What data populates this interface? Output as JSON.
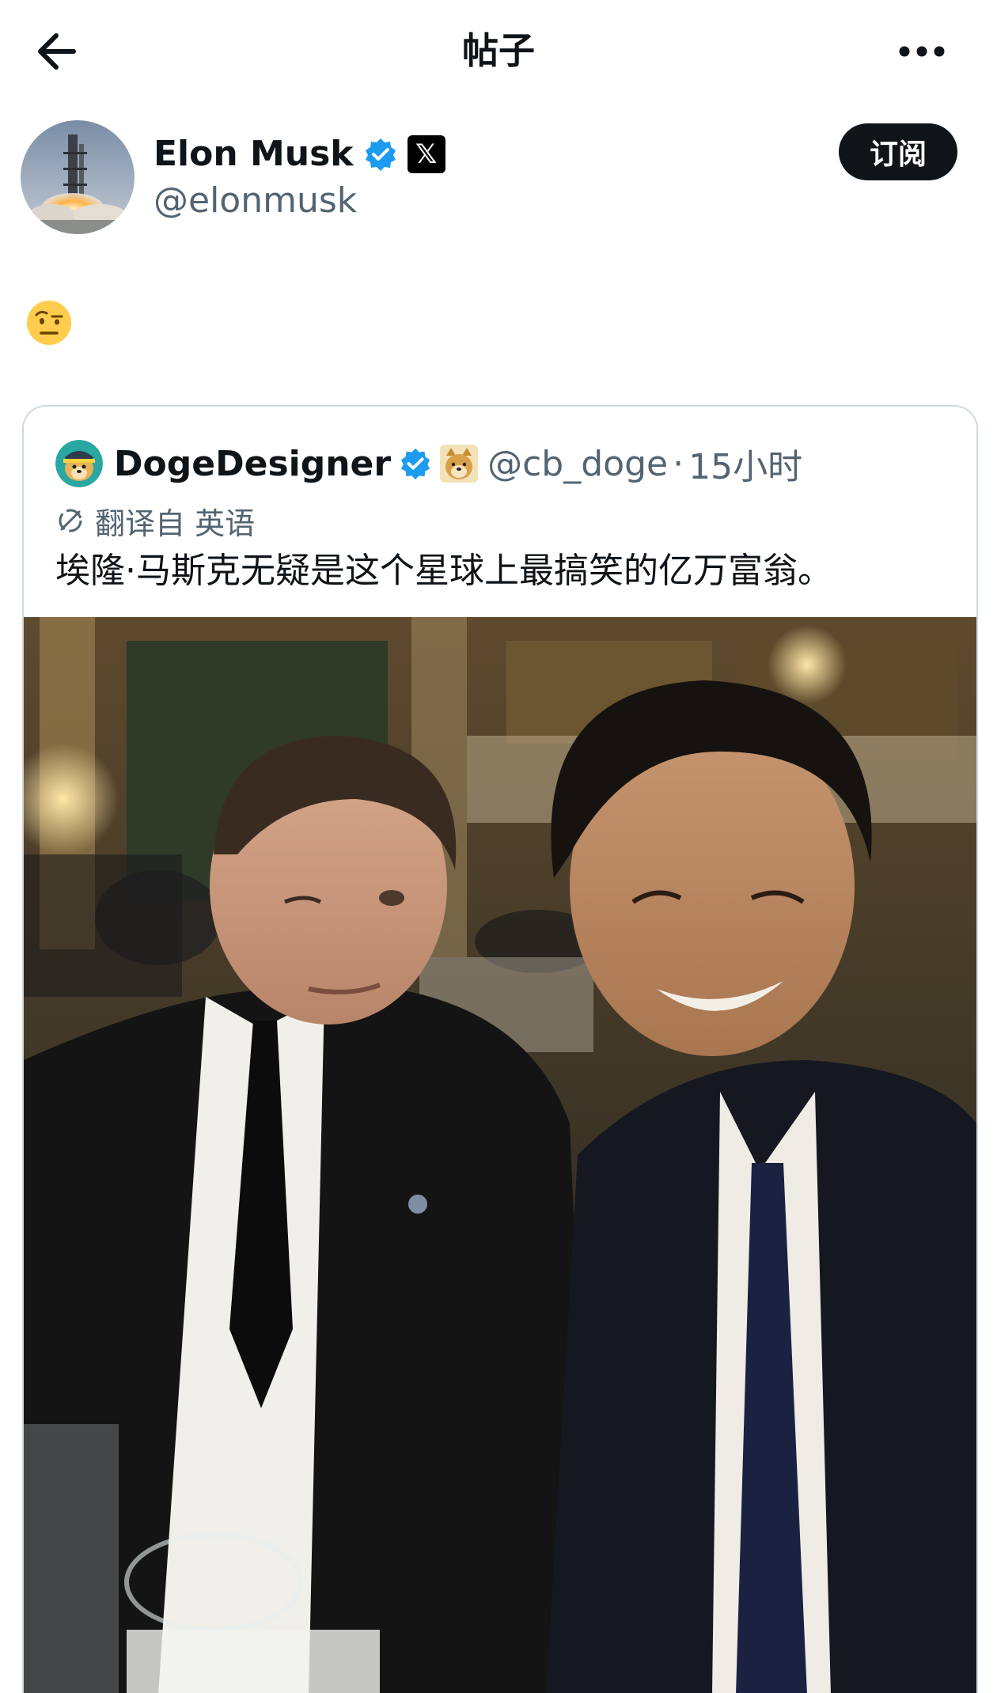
{
  "header": {
    "title": "帖子",
    "back_icon": "arrow-left-icon",
    "more_icon": "more-horizontal-icon"
  },
  "author": {
    "name": "Elon Musk",
    "handle": "@elonmusk",
    "verified": true,
    "subscribe_label": "订阅"
  },
  "post": {
    "body_emoji_icon": "face-with-raised-eyebrow-emoji"
  },
  "quote": {
    "name": "DogeDesigner",
    "handle": "@cb_doge",
    "separator": "·",
    "time": "15小时",
    "translate_label": "翻译自 英语",
    "text": "埃隆·马斯克无疑是这个星球上最搞笑的亿万富翁。",
    "media": "photo-two-men-selfie-at-banquet"
  },
  "colors": {
    "accent_blue": "#1d9bf0",
    "text_primary": "#0f1419",
    "text_secondary": "#536471",
    "border": "#cfd9de"
  }
}
